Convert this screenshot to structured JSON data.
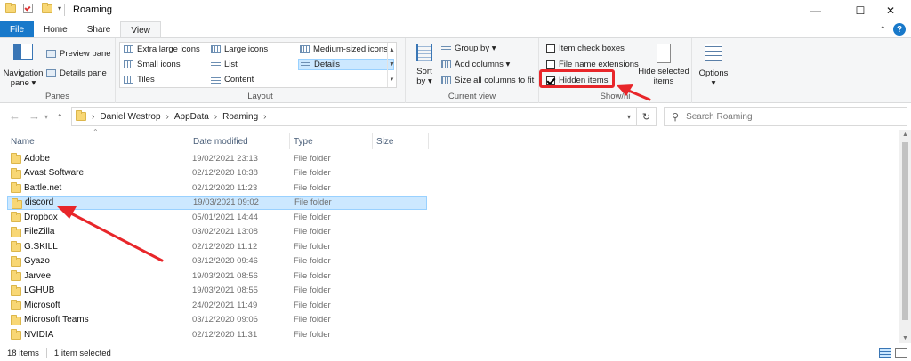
{
  "window": {
    "title": "Roaming",
    "controls": {
      "minimize": "—",
      "maximize": "☐",
      "close": "✕"
    }
  },
  "ribbon_tabs": {
    "file": "File",
    "home": "Home",
    "share": "Share",
    "view": "View"
  },
  "ribbon": {
    "panes": {
      "navigation_pane": "Navigation",
      "navigation_pane_2": "pane ▾",
      "preview_pane": "Preview pane",
      "details_pane": "Details pane",
      "label": "Panes"
    },
    "layout": {
      "extra_large_icons": "Extra large icons",
      "large_icons": "Large icons",
      "medium_icons": "Medium-sized icons",
      "small_icons": "Small icons",
      "list": "List",
      "details": "Details",
      "tiles": "Tiles",
      "content": "Content",
      "label": "Layout"
    },
    "current_view": {
      "sort_by": "Sort",
      "sort_by_2": "by ▾",
      "group_by": "Group by ▾",
      "add_columns": "Add columns ▾",
      "size_all": "Size all columns to fit",
      "label": "Current view"
    },
    "show_hide": {
      "item_check_boxes": "Item check boxes",
      "file_name_extensions": "File name extensions",
      "hidden_items": "Hidden items",
      "hide_selected": "Hide selected",
      "hide_selected_2": "items",
      "label": "Show/hi"
    },
    "options": {
      "label": "Options",
      "caret": "▾"
    }
  },
  "address": {
    "crumbs": [
      "Daniel Westrop",
      "AppData",
      "Roaming"
    ],
    "search_placeholder": "Search Roaming"
  },
  "columns": {
    "name": "Name",
    "date": "Date modified",
    "type": "Type",
    "size": "Size"
  },
  "files": [
    {
      "name": "Adobe",
      "date": "19/02/2021 23:13",
      "type": "File folder"
    },
    {
      "name": "Avast Software",
      "date": "02/12/2020 10:38",
      "type": "File folder"
    },
    {
      "name": "Battle.net",
      "date": "02/12/2020 11:23",
      "type": "File folder"
    },
    {
      "name": "discord",
      "date": "19/03/2021 09:02",
      "type": "File folder"
    },
    {
      "name": "Dropbox",
      "date": "05/01/2021 14:44",
      "type": "File folder"
    },
    {
      "name": "FileZilla",
      "date": "03/02/2021 13:08",
      "type": "File folder"
    },
    {
      "name": "G.SKILL",
      "date": "02/12/2020 11:12",
      "type": "File folder"
    },
    {
      "name": "Gyazo",
      "date": "03/12/2020 09:46",
      "type": "File folder"
    },
    {
      "name": "Jarvee",
      "date": "19/03/2021 08:56",
      "type": "File folder"
    },
    {
      "name": "LGHUB",
      "date": "19/03/2021 08:55",
      "type": "File folder"
    },
    {
      "name": "Microsoft",
      "date": "24/02/2021 11:49",
      "type": "File folder"
    },
    {
      "name": "Microsoft Teams",
      "date": "03/12/2020 09:06",
      "type": "File folder"
    },
    {
      "name": "NVIDIA",
      "date": "02/12/2020 11:31",
      "type": "File folder"
    }
  ],
  "selected_index": 3,
  "status": {
    "count": "18 items",
    "selected": "1 item selected"
  },
  "colors": {
    "accent": "#1979ca",
    "selection": "#cce8ff",
    "annotation": "#e8262a"
  }
}
